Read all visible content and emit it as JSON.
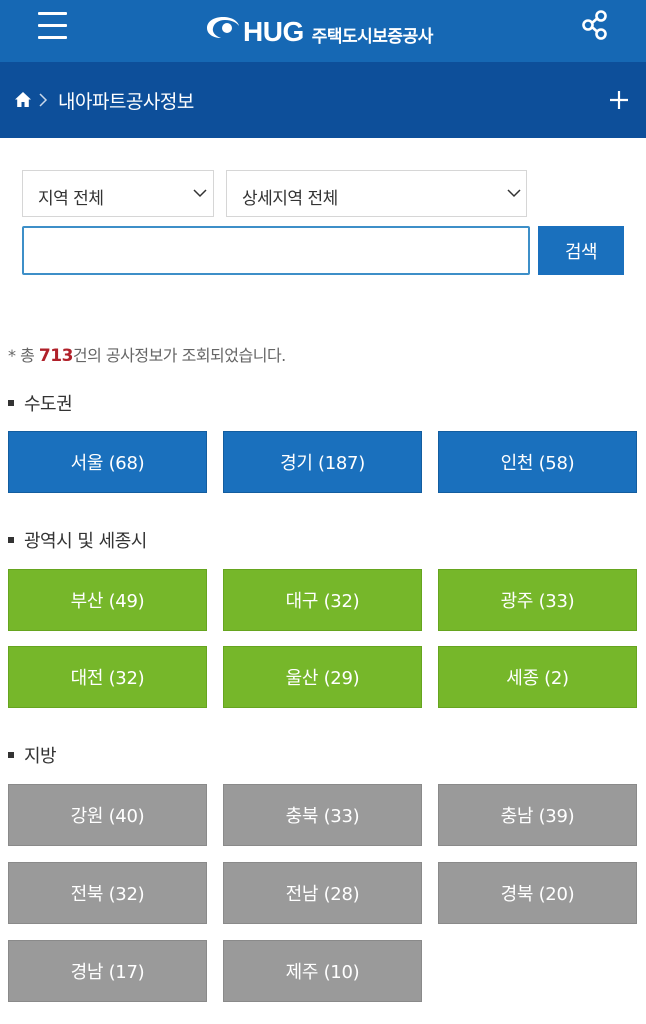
{
  "header": {
    "logo_text": "HUG",
    "logo_subtitle": "주택도시보증공사",
    "icons": {
      "menu": "hamburger-menu-icon",
      "share": "share-icon"
    },
    "brand_color": "#1668b4"
  },
  "breadcrumb": {
    "title": "내아파트공사정보",
    "icons": {
      "home": "home-icon",
      "separator": "chevron-right-icon",
      "expand": "plus-icon"
    }
  },
  "search": {
    "region_select": "지역 전체",
    "detail_select": "상세지역 전체",
    "input_value": "",
    "button_label": "검색"
  },
  "result": {
    "prefix": "* 총 ",
    "count": "713",
    "suffix": "건의 공사정보가 조회되었습니다."
  },
  "sections": [
    {
      "title": "수도권",
      "color": "#1a70bd",
      "items": [
        {
          "label": "서울 (68)"
        },
        {
          "label": "경기 (187)"
        },
        {
          "label": "인천 (58)"
        }
      ]
    },
    {
      "title": "광역시 및 세종시",
      "color": "#76b72a",
      "items": [
        {
          "label": "부산 (49)"
        },
        {
          "label": "대구 (32)"
        },
        {
          "label": "광주 (33)"
        },
        {
          "label": "대전 (32)"
        },
        {
          "label": "울산 (29)"
        },
        {
          "label": "세종 (2)"
        }
      ]
    },
    {
      "title": "지방",
      "color": "#9a9a9a",
      "items": [
        {
          "label": "강원 (40)"
        },
        {
          "label": "충북 (33)"
        },
        {
          "label": "충남 (39)"
        },
        {
          "label": "전북 (32)"
        },
        {
          "label": "전남 (28)"
        },
        {
          "label": "경북 (20)"
        },
        {
          "label": "경남 (17)"
        },
        {
          "label": "제주 (10)"
        }
      ]
    }
  ]
}
